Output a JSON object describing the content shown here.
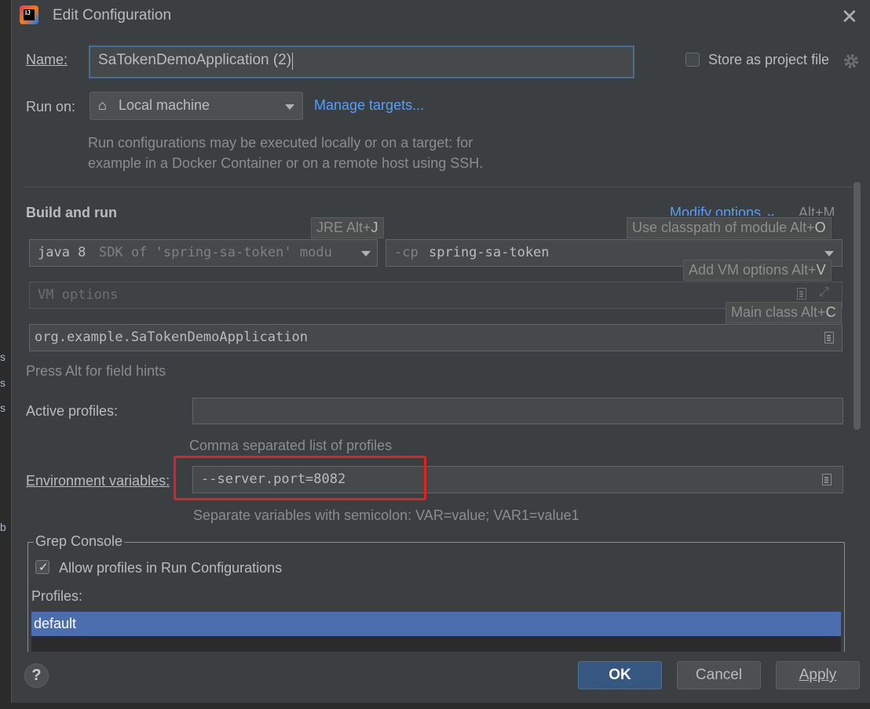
{
  "window": {
    "title": "Edit Configuration",
    "app_icon_text": "IJ"
  },
  "editor_edge": {
    "chars": [
      "s",
      "s",
      "s",
      "b"
    ]
  },
  "name_row": {
    "label": "Name:",
    "value": "SaTokenDemoApplication (2)"
  },
  "store": {
    "label": "Store as project file",
    "checked": false
  },
  "run_on": {
    "label": "Run on:",
    "value": "Local machine",
    "manage_link": "Manage targets..."
  },
  "run_hint": {
    "line1": "Run configurations may be executed locally or on a target: for",
    "line2": "example in a Docker Container or on a remote host using SSH."
  },
  "build_and_run": {
    "title": "Build and run",
    "modify_options": "Modify options",
    "modify_shortcut": "Alt+M",
    "jre_value": "java 8",
    "jre_detail": "SDK of 'spring-sa-token' modu",
    "cp_prefix": "-cp",
    "cp_value": "spring-sa-token",
    "vm_placeholder": "VM options",
    "main_class": "org.example.SaTokenDemoApplication",
    "field_hint": "Press Alt for field hints"
  },
  "tooltips": {
    "jre": "JRE Alt+",
    "jre_key": "J",
    "classpath": "Use classpath of module Alt+",
    "classpath_key": "O",
    "vm": "Add VM options Alt+",
    "vm_key": "V",
    "main": "Main class Alt+",
    "main_key": "C"
  },
  "active_profiles": {
    "label": "Active profiles:",
    "value": "",
    "hint": "Comma separated list of profiles"
  },
  "env": {
    "label": "Environment variables:",
    "value": "--server.port=8082",
    "hint": "Separate variables with semicolon: VAR=value; VAR1=value1"
  },
  "grep_console": {
    "title": "Grep Console",
    "allow_label": "Allow profiles in Run Configurations",
    "allow_checked": true,
    "profiles_label": "Profiles:",
    "profiles": [
      "default"
    ]
  },
  "buttons": {
    "help": "?",
    "ok": "OK",
    "cancel": "Cancel",
    "apply": "Apply"
  },
  "colors": {
    "background": "#3c3f41",
    "accent": "#589df6",
    "ok_button": "#365880",
    "highlight_box": "#e41f1f",
    "selection": "#4b6eaf"
  }
}
